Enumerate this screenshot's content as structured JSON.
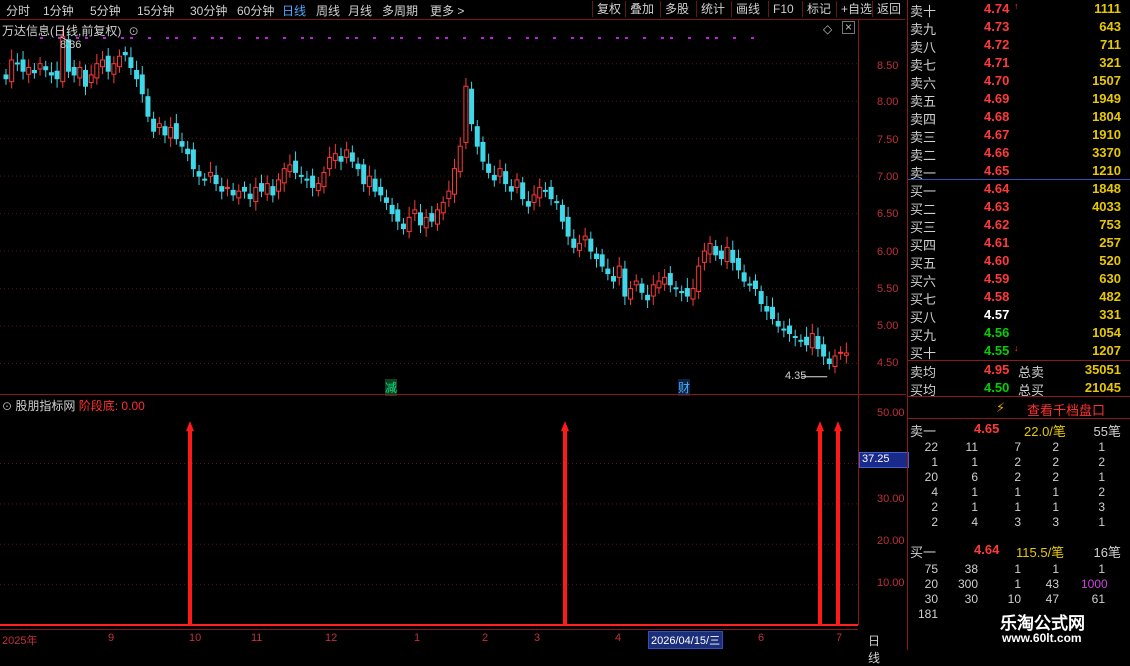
{
  "toolbar": {
    "periods": [
      "分时",
      "1分钟",
      "5分钟",
      "15分钟",
      "30分钟",
      "60分钟",
      "日线",
      "周线",
      "月线",
      "多周期",
      "更多 >"
    ],
    "active_period": "日线",
    "buttons": [
      "复权",
      "叠加",
      "多股",
      "统计",
      "画线",
      "F10",
      "标记",
      "+自选",
      "返回"
    ]
  },
  "main_chart": {
    "title": "万达信息(日线,前复权)",
    "y_ticks": [
      "8.50",
      "8.00",
      "7.50",
      "7.00",
      "6.50",
      "6.00",
      "5.50",
      "5.00",
      "4.50"
    ],
    "high_label": "8.86",
    "low_label": "4.35",
    "event_marks": [
      "减",
      "财"
    ]
  },
  "sub_chart": {
    "title": "股朋指标网",
    "indicator": "阶段底: 0.00",
    "y_ticks": [
      "50.00",
      "40.00",
      "30.00",
      "20.00",
      "10.00"
    ],
    "cursor_value": "37.25"
  },
  "x_axis": {
    "labels": [
      "2025年",
      "9",
      "10",
      "11",
      "12",
      "1",
      "2",
      "3",
      "4",
      "6",
      "7"
    ],
    "cursor_date": "2026/04/15/三",
    "period_label": "日线"
  },
  "chart_data": {
    "type": "candlestick",
    "title": "万达信息(日线,前复权)",
    "ylim": [
      4.2,
      8.95
    ],
    "close_series": [
      8.3,
      8.55,
      8.5,
      8.4,
      8.45,
      8.38,
      8.5,
      8.42,
      8.35,
      8.3,
      8.86,
      8.4,
      8.35,
      8.45,
      8.2,
      8.35,
      8.5,
      8.55,
      8.4,
      8.5,
      8.6,
      8.62,
      8.45,
      8.3,
      8.1,
      7.8,
      7.6,
      7.7,
      7.55,
      7.65,
      7.5,
      7.4,
      7.3,
      7.1,
      7.0,
      6.95,
      7.05,
      6.9,
      6.8,
      6.85,
      6.75,
      6.8,
      6.8,
      6.7,
      6.85,
      6.8,
      6.9,
      6.75,
      6.95,
      7.1,
      7.15,
      7.05,
      7.0,
      6.95,
      6.85,
      6.9,
      7.05,
      7.25,
      7.3,
      7.2,
      7.35,
      7.2,
      7.1,
      6.9,
      7.0,
      6.8,
      6.75,
      6.65,
      6.5,
      6.4,
      6.3,
      6.45,
      6.55,
      6.35,
      6.45,
      6.4,
      6.55,
      6.65,
      6.8,
      7.1,
      7.4,
      8.2,
      7.7,
      7.4,
      7.2,
      7.05,
      6.95,
      7.1,
      6.9,
      6.8,
      6.95,
      6.7,
      6.6,
      6.75,
      6.85,
      6.8,
      6.7,
      6.65,
      6.4,
      6.2,
      6.05,
      6.1,
      6.2,
      6.0,
      5.9,
      5.8,
      5.7,
      5.6,
      5.8,
      5.4,
      5.5,
      5.6,
      5.45,
      5.35,
      5.55,
      5.6,
      5.65,
      5.55,
      5.5,
      5.45,
      5.4,
      5.5,
      5.8,
      6.0,
      6.1,
      5.95,
      5.9,
      6.05,
      5.85,
      5.75,
      5.6,
      5.55,
      5.5,
      5.3,
      5.2,
      5.1,
      5.0,
      4.95,
      4.9,
      4.85,
      4.8,
      4.75,
      4.9,
      4.7,
      4.6,
      4.5,
      4.6,
      4.65,
      4.64
    ],
    "sub_series": {
      "name": "阶段底",
      "signal_bars": [
        190,
        565,
        820,
        838
      ],
      "signal_value": 50
    }
  },
  "order_book": {
    "asks": [
      {
        "label": "卖十",
        "price": "4.74",
        "vol": "1111",
        "flag": "↑"
      },
      {
        "label": "卖九",
        "price": "4.73",
        "vol": "643"
      },
      {
        "label": "卖八",
        "price": "4.72",
        "vol": "711"
      },
      {
        "label": "卖七",
        "price": "4.71",
        "vol": "321"
      },
      {
        "label": "卖六",
        "price": "4.70",
        "vol": "1507"
      },
      {
        "label": "卖五",
        "price": "4.69",
        "vol": "1949"
      },
      {
        "label": "卖四",
        "price": "4.68",
        "vol": "1804"
      },
      {
        "label": "卖三",
        "price": "4.67",
        "vol": "1910"
      },
      {
        "label": "卖二",
        "price": "4.66",
        "vol": "3370"
      },
      {
        "label": "卖一",
        "price": "4.65",
        "vol": "1210"
      }
    ],
    "bids": [
      {
        "label": "买一",
        "price": "4.64",
        "vol": "1848",
        "dir": "up"
      },
      {
        "label": "买二",
        "price": "4.63",
        "vol": "4033",
        "dir": "up"
      },
      {
        "label": "买三",
        "price": "4.62",
        "vol": "753",
        "dir": "up"
      },
      {
        "label": "买四",
        "price": "4.61",
        "vol": "257",
        "dir": "up"
      },
      {
        "label": "买五",
        "price": "4.60",
        "vol": "520",
        "dir": "up"
      },
      {
        "label": "买六",
        "price": "4.59",
        "vol": "630",
        "dir": "up"
      },
      {
        "label": "买七",
        "price": "4.58",
        "vol": "482",
        "dir": "up"
      },
      {
        "label": "买八",
        "price": "4.57",
        "vol": "331",
        "dir": "eq"
      },
      {
        "label": "买九",
        "price": "4.56",
        "vol": "1054",
        "dir": "dn"
      },
      {
        "label": "买十",
        "price": "4.55",
        "vol": "1207",
        "dir": "dn",
        "flag": "↓"
      }
    ],
    "avg_sell": {
      "label": "卖均",
      "price": "4.95",
      "total_label": "总卖",
      "total": "35051"
    },
    "avg_buy": {
      "label": "买均",
      "price": "4.50",
      "total_label": "总买",
      "total": "21045"
    }
  },
  "qianbang": {
    "button": "查看千档盘口",
    "sell": {
      "label": "卖一",
      "price": "4.65",
      "per": "22.0/笔",
      "count": "55笔"
    },
    "sell_rows": [
      [
        "22",
        "11",
        "7",
        "2",
        "1"
      ],
      [
        "1",
        "1",
        "2",
        "2",
        "2"
      ],
      [
        "20",
        "6",
        "2",
        "2",
        "1"
      ],
      [
        "4",
        "1",
        "1",
        "1",
        "2"
      ],
      [
        "2",
        "1",
        "1",
        "1",
        "3"
      ],
      [
        "2",
        "4",
        "3",
        "3",
        "1"
      ]
    ],
    "buy": {
      "label": "买一",
      "price": "4.64",
      "per": "115.5/笔",
      "count": "16笔"
    },
    "buy_rows": [
      [
        "75",
        "38",
        "1",
        "1",
        "1"
      ],
      [
        "20",
        "300",
        "1",
        "43",
        "1000"
      ],
      [
        "30",
        "30",
        "10",
        "47",
        "61"
      ],
      [
        "181",
        "",
        "",
        "",
        ""
      ]
    ]
  },
  "watermark": {
    "line1": "乐淘公式网",
    "line2": "www.60lt.com"
  }
}
